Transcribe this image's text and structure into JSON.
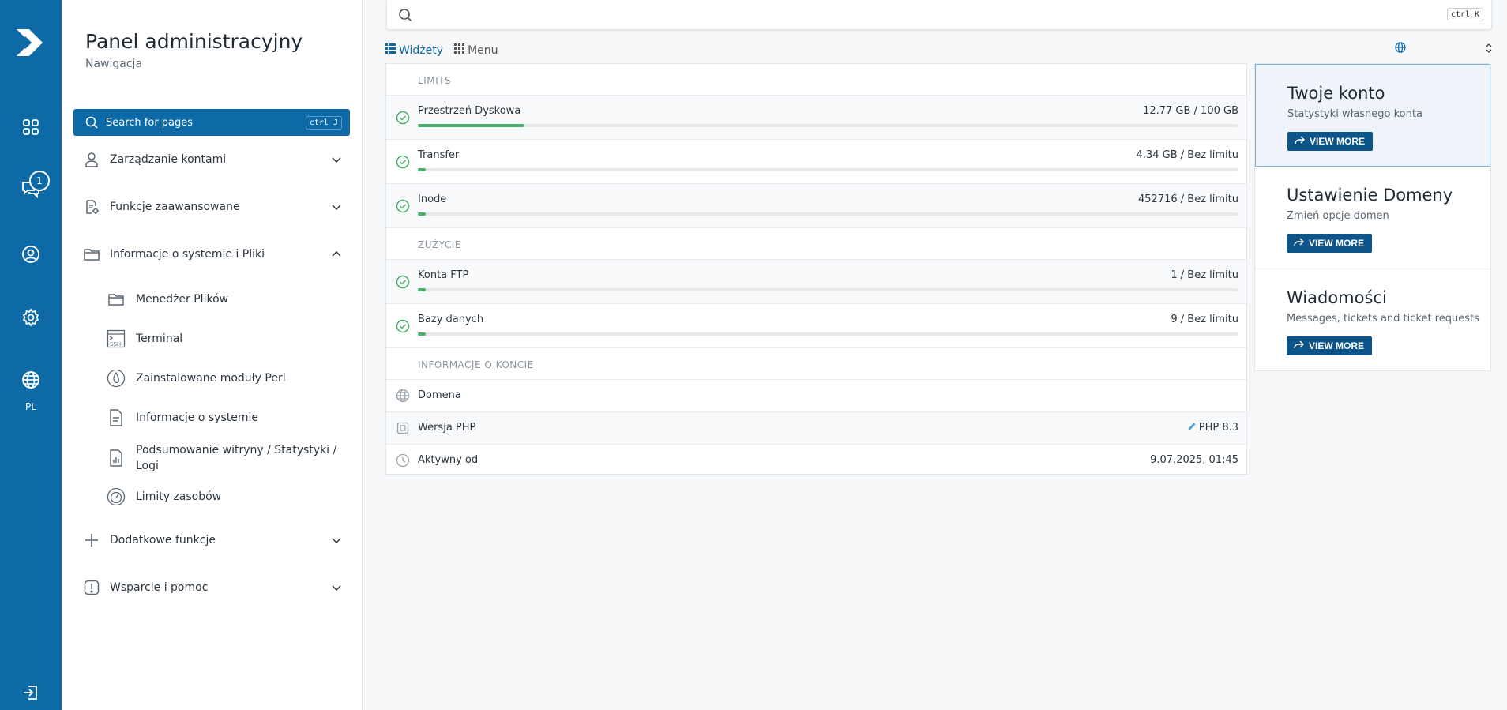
{
  "rail": {
    "badge_count": "1",
    "lang": "PL"
  },
  "nav": {
    "title": "Panel administracyjny",
    "subtitle": "Nawigacja",
    "search_label": "Search for pages",
    "search_kbd": "ctrl J",
    "groups": [
      {
        "label": "Zarządzanie kontami",
        "icon": "user-icon",
        "expanded": false
      },
      {
        "label": "Funkcje zaawansowane",
        "icon": "advanced-settings-icon",
        "expanded": false
      },
      {
        "label": "Informacje o systemie i Pliki",
        "icon": "folder-icon",
        "expanded": true
      },
      {
        "label": "Dodatkowe funkcje",
        "icon": "plus-icon",
        "expanded": false
      },
      {
        "label": "Wsparcie i pomoc",
        "icon": "alert-icon",
        "expanded": false
      }
    ],
    "sub_items": [
      {
        "label": "Menedżer Plików",
        "icon": "folder-icon"
      },
      {
        "label": "Terminal",
        "icon": "ssh-terminal-icon"
      },
      {
        "label": "Zainstalowane moduły Perl",
        "icon": "perl-icon"
      },
      {
        "label": "Informacje o systemie",
        "icon": "document-icon"
      },
      {
        "label": "Podsumowanie witryny / Statystyki / Logi",
        "icon": "stats-icon"
      },
      {
        "label": "Limity zasobów",
        "icon": "gauge-icon"
      }
    ]
  },
  "topsearch": {
    "placeholder": "",
    "kbd": "ctrl K"
  },
  "tabs": [
    {
      "label": "Widżety",
      "icon": "list-icon",
      "active": true
    },
    {
      "label": "Menu",
      "icon": "grid-icon",
      "active": false
    }
  ],
  "widget": {
    "sections": {
      "limits": "LIMITS",
      "usage": "ZUŻYCIE",
      "account": "INFORMACJE O KONCIE"
    },
    "limits": [
      {
        "label": "Przestrzeń Dyskowa",
        "value": "12.77 GB / 100 GB",
        "fraction": 0.13
      },
      {
        "label": "Transfer",
        "value": "4.34 GB / Bez limitu",
        "fraction": 0.01
      },
      {
        "label": "Inode",
        "value": "452716 / Bez limitu",
        "fraction": 0.01
      }
    ],
    "usage": [
      {
        "label": "Konta FTP",
        "value": "1 / Bez limitu",
        "fraction": 0.01
      },
      {
        "label": "Bazy danych",
        "value": "9 / Bez limitu",
        "fraction": 0.01
      }
    ],
    "account": [
      {
        "label": "Domena",
        "value": "",
        "icon": "globe-icon"
      },
      {
        "label": "Wersja PHP",
        "value": "PHP 8.3",
        "icon": "chip-icon"
      },
      {
        "label": "Aktywny od",
        "value": "9.07.2025, 01:45",
        "icon": "clock-icon"
      }
    ]
  },
  "cards": [
    {
      "title": "Twoje konto",
      "subtitle": "Statystyki własnego konta",
      "button": "VIEW MORE"
    },
    {
      "title": "Ustawienie Domeny",
      "subtitle": "Zmień opcje domen",
      "button": "VIEW MORE"
    },
    {
      "title": "Wiadomości",
      "subtitle": "Messages, tickets and ticket requests",
      "button": "VIEW MORE"
    }
  ],
  "colors": {
    "primary": "#0d6aa6",
    "progress": "#4caf6e",
    "check": "#4caf6e",
    "php_link": "#4aa7d9"
  }
}
